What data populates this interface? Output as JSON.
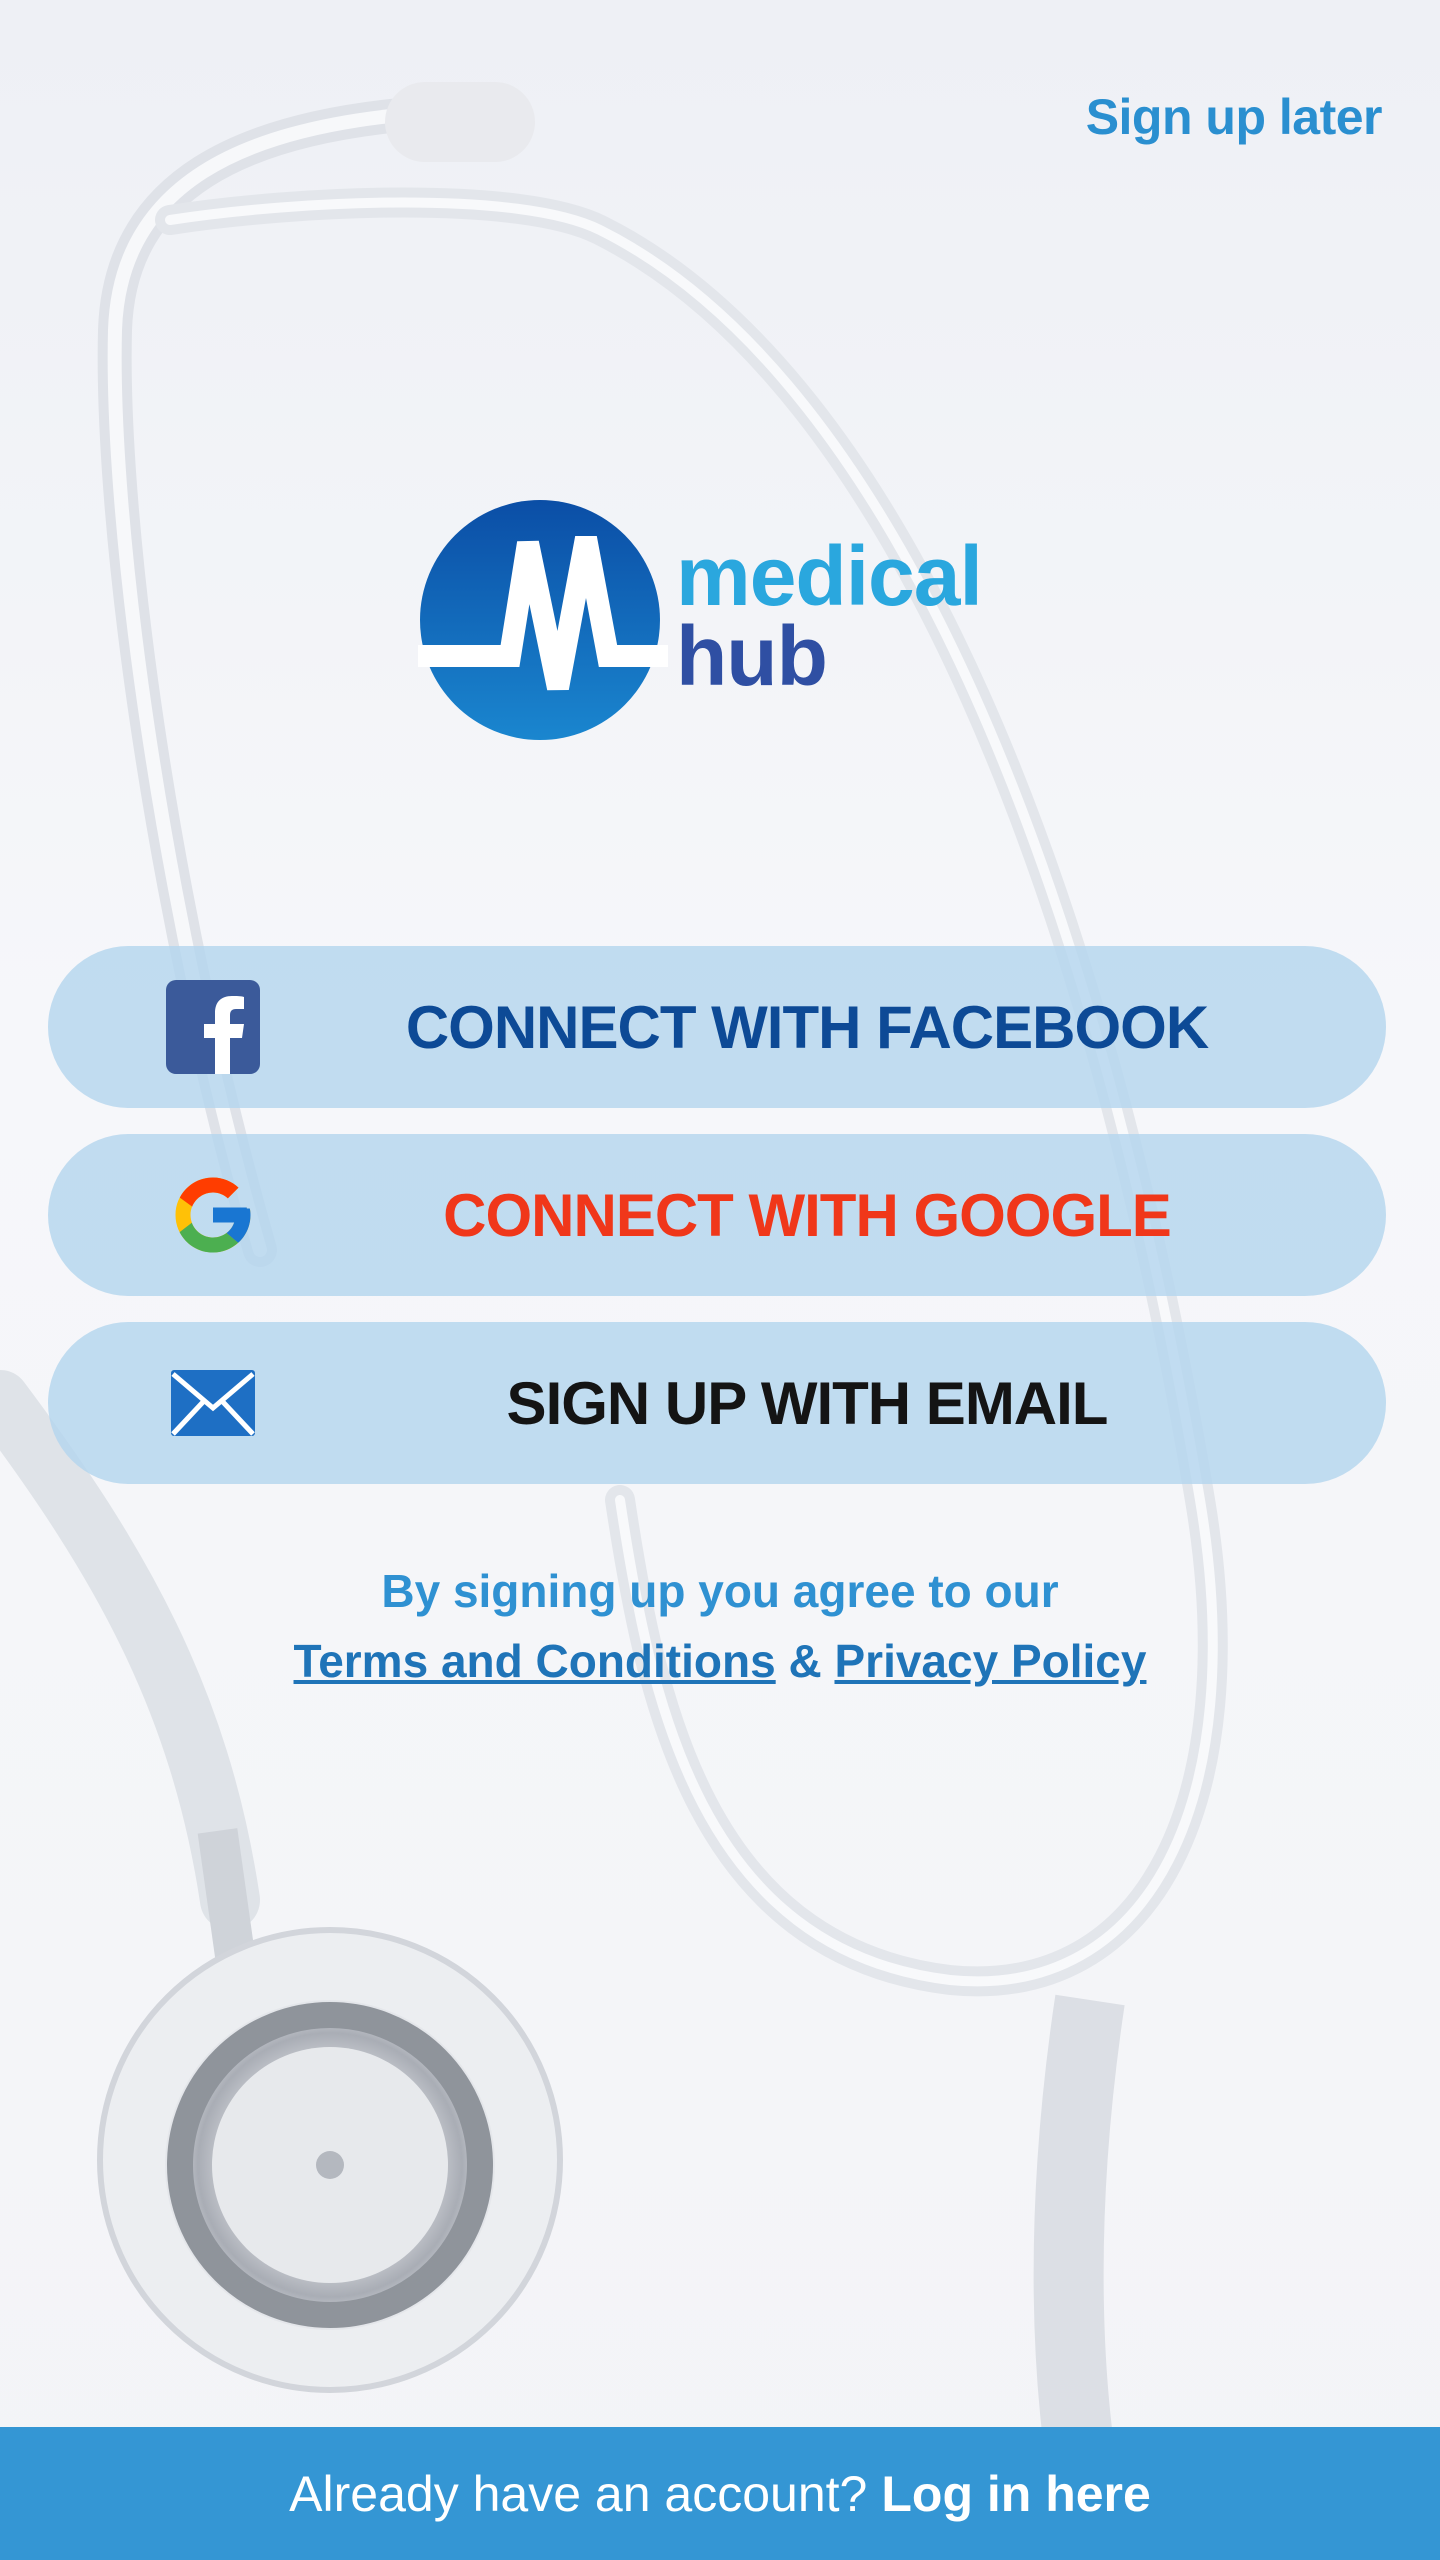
{
  "header": {
    "skip_label": "Sign up later"
  },
  "logo": {
    "word1": "medical",
    "word2": "hub"
  },
  "buttons": {
    "facebook": {
      "label": "CONNECT WITH FACEBOOK",
      "icon": "facebook-icon"
    },
    "google": {
      "label": "CONNECT WITH GOOGLE",
      "icon": "google-icon"
    },
    "email": {
      "label": "SIGN UP WITH EMAIL",
      "icon": "mail-icon"
    }
  },
  "terms": {
    "line1": "By signing up you agree to our",
    "terms_link": "Terms and Conditions",
    "ampersand": "&",
    "privacy_link": "Privacy Policy"
  },
  "footer": {
    "prompt": "Already have an account?",
    "login_link": "Log in here"
  },
  "colors": {
    "accent": "#3496d4",
    "facebook_text": "#0d4a96",
    "google_text": "#f0371a",
    "email_text": "#141414",
    "button_bg": "#b4d5ee"
  }
}
